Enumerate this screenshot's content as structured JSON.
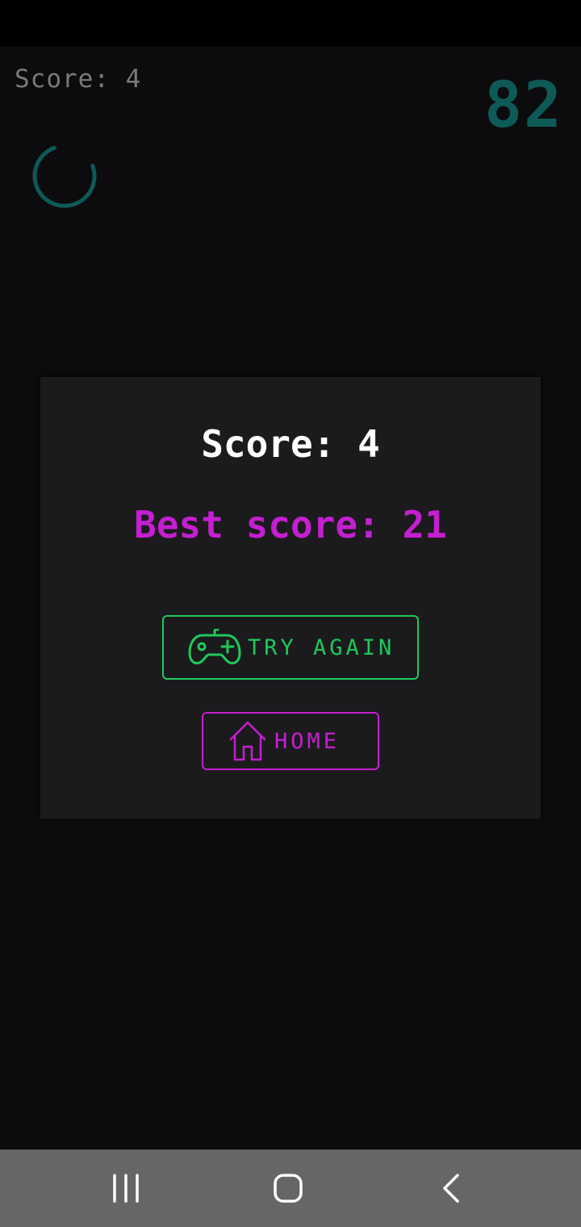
{
  "hud": {
    "score_text": "Score: 4",
    "timer": "82"
  },
  "dialog": {
    "score_text": "Score: 4",
    "best_score_text": "Best score: 21",
    "try_again_label": "TRY AGAIN",
    "home_label": "HOME"
  },
  "icons": {
    "try_again": "gamepad-icon",
    "home": "home-icon",
    "loading": "spinner-icon"
  },
  "nav": {
    "items": [
      "recent-apps-icon",
      "home-circle-icon",
      "back-icon"
    ]
  },
  "colors": {
    "accent_green": "#1ec95a",
    "accent_magenta": "#c41fd0",
    "timer_teal": "#0e5a57",
    "dialog_bg": "#1b1b1d"
  }
}
